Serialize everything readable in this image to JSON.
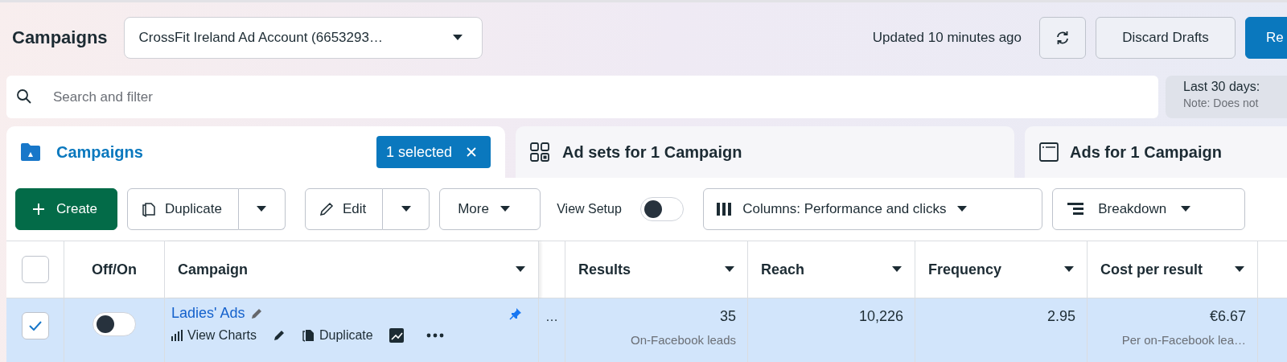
{
  "header": {
    "title": "Campaigns",
    "account_selector": "CrossFit Ireland Ad Account (6653293…",
    "updated": "Updated 10 minutes ago",
    "discard_button": "Discard Drafts",
    "primary_button": "Re"
  },
  "search": {
    "placeholder": "Search and filter"
  },
  "date_range": {
    "label": "Last 30 days:",
    "note": "Note: Does not"
  },
  "tabs": [
    {
      "label": "Campaigns",
      "selected": true,
      "badge": "1 selected"
    },
    {
      "label": "Ad sets for 1 Campaign",
      "selected": false
    },
    {
      "label": "Ads for 1 Campaign",
      "selected": false
    }
  ],
  "toolbar": {
    "create": "Create",
    "duplicate": "Duplicate",
    "edit": "Edit",
    "more": "More",
    "view_setup": {
      "label": "View Setup",
      "on": false
    },
    "columns": "Columns: Performance and clicks",
    "breakdown": "Breakdown"
  },
  "table": {
    "select_all": {
      "checked": false
    },
    "columns": [
      {
        "label": "Off/On"
      },
      {
        "label": "Campaign"
      },
      {
        "label": "Results"
      },
      {
        "label": "Reach"
      },
      {
        "label": "Frequency"
      },
      {
        "label": "Cost per result"
      }
    ],
    "rows": [
      {
        "selected": true,
        "on": false,
        "name": "Ladies' Ads",
        "pinned": true,
        "actions": [
          "View Charts",
          "Duplicate"
        ],
        "column_3": "…",
        "results": "35",
        "results_note": "On-Facebook leads",
        "reach": "10,226",
        "frequency": "2.95",
        "cost_per_result": "€6.67",
        "cost_note": "Per on-Facebook lea…"
      }
    ]
  }
}
